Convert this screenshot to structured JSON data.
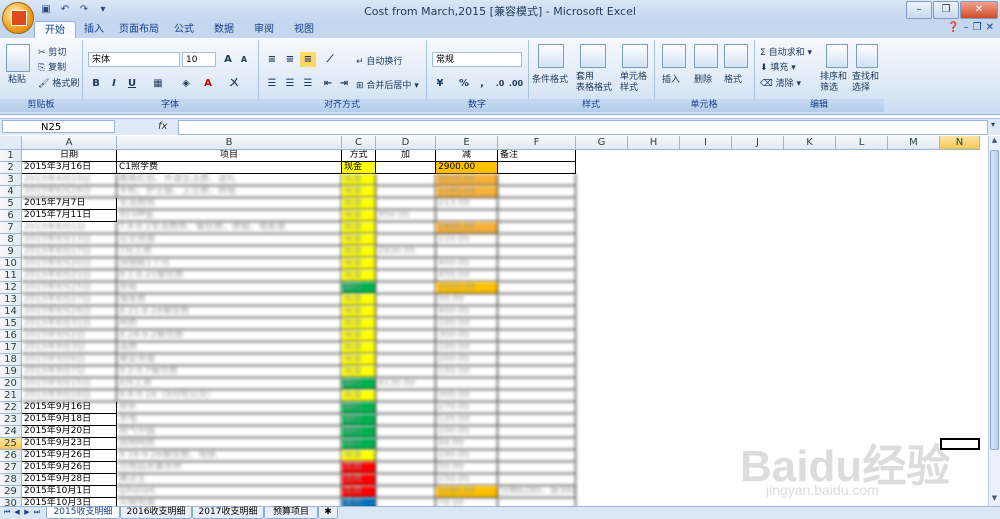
{
  "window": {
    "title": "Cost from March,2015  [兼容模式] - Microsoft Excel",
    "controls": [
      "minimize-icon",
      "restore-icon",
      "close-icon"
    ]
  },
  "ribbon_tabs": [
    "开始",
    "插入",
    "页面布局",
    "公式",
    "数据",
    "审阅",
    "视图"
  ],
  "ribbon": {
    "clipboard": {
      "paste": "粘贴",
      "cut": "剪切",
      "copy": "复制",
      "format_painter": "格式刷",
      "label": "剪贴板"
    },
    "font": {
      "name": "宋体",
      "size": "10",
      "bold": "B",
      "italic": "I",
      "underline": "U",
      "label": "字体"
    },
    "alignment": {
      "wrap": "自动换行",
      "merge": "合并后居中",
      "label": "对齐方式"
    },
    "number": {
      "format": "常规",
      "percent": "%",
      "comma": ",",
      "label": "数字"
    },
    "styles": {
      "conditional": "条件格式",
      "table": "套用\n表格格式",
      "cell": "单元格\n样式",
      "label": "样式"
    },
    "cells": {
      "insert": "插入",
      "delete": "删除",
      "format": "格式",
      "label": "单元格"
    },
    "editing": {
      "autosum": "自动求和",
      "fill": "填充",
      "clear": "清除",
      "sort": "排序和\n筛选",
      "find": "查找和\n选择",
      "label": "编辑"
    }
  },
  "formula_bar": {
    "name_box": "N25",
    "fx": "fx",
    "value": ""
  },
  "columns": [
    "A",
    "B",
    "C",
    "D",
    "E",
    "F",
    "G",
    "H",
    "I",
    "J",
    "K",
    "L",
    "M",
    "N"
  ],
  "selected_column": "N",
  "selected_row": 25,
  "header_row": {
    "date": "日期",
    "item": "项目",
    "method": "方式",
    "add": "加",
    "subtract": "减",
    "note": "备注"
  },
  "rows": [
    {
      "n": 2,
      "date": "2015年3月16日",
      "item": "C1照学费",
      "method": "现金",
      "add": "",
      "sub": "2900.00",
      "note": "",
      "mc": "#ffff00",
      "sc": "#ffc000"
    },
    {
      "n": 3,
      "date": "2015年4月10日",
      "item": "教练红包、外请生活费、送礼",
      "method": "现金",
      "add": "",
      "sub": "5670.00",
      "note": "",
      "mc": "#ffff00",
      "sc": "#f6b13a"
    },
    {
      "n": 4,
      "date": "2015年6月28日",
      "item": "手机、护士服、上交费、房租",
      "method": "现金",
      "add": "",
      "sub": "2185.00",
      "note": "",
      "mc": "#ffff00",
      "sc": "#f6b13a"
    },
    {
      "n": 5,
      "date": "2015年7月7日",
      "item": "生活费用",
      "method": "现金",
      "add": "",
      "sub": "213.00",
      "note": "",
      "mc": "#ffff00",
      "sc": ""
    },
    {
      "n": 6,
      "date": "2015年7月11日",
      "item": "803押金",
      "method": "现金",
      "add": "950.00",
      "sub": "",
      "note": "",
      "mc": "#ffff00",
      "sc": ""
    },
    {
      "n": 7,
      "date": "2015年8月1日",
      "item": "7.8-8.1生活费用、餐饮费、房租、电影票",
      "method": "现金",
      "add": "",
      "sub": "1800.00",
      "note": "",
      "mc": "#ffff00",
      "sc": "#f6b13a"
    },
    {
      "n": 8,
      "date": "2015年8月13日",
      "item": "公交充值",
      "method": "现金",
      "add": "",
      "sub": "110.00",
      "note": "",
      "mc": "#ffff00",
      "sc": ""
    },
    {
      "n": 9,
      "date": "2015年8月17日",
      "item": "7月工资",
      "method": "现金",
      "add": "2830.00",
      "sub": "",
      "note": "",
      "mc": "#ffff00",
      "sc": ""
    },
    {
      "n": 10,
      "date": "2015年8月20日",
      "item": "预借款1个月",
      "method": "现金",
      "add": "",
      "sub": "400.00",
      "note": "",
      "mc": "#ffff00",
      "sc": ""
    },
    {
      "n": 11,
      "date": "2015年8月21日",
      "item": "8.1-8.21餐饮费",
      "method": "现金",
      "add": "",
      "sub": "450.00",
      "note": "",
      "mc": "#ffff00",
      "sc": ""
    },
    {
      "n": 12,
      "date": "2015年8月25日",
      "item": "房租",
      "method": "银行",
      "add": "",
      "sub": "2000.00",
      "note": "",
      "mc": "#00b050",
      "sc": "#ffc000"
    },
    {
      "n": 13,
      "date": "2015年8月27日",
      "item": "理发费",
      "method": "现金",
      "add": "",
      "sub": "50.00",
      "note": "",
      "mc": "#ffff00",
      "sc": ""
    },
    {
      "n": 14,
      "date": "2015年8月28日",
      "item": "8.21-8.28餐饮费",
      "method": "现金",
      "add": "",
      "sub": "400.00",
      "note": "",
      "mc": "#ffff00",
      "sc": ""
    },
    {
      "n": 15,
      "date": "2015年8月31日",
      "item": "网费",
      "method": "现金",
      "add": "",
      "sub": "100.00",
      "note": "",
      "mc": "#ffff00",
      "sc": ""
    },
    {
      "n": 16,
      "date": "2015年9月2日",
      "item": "8.28-9.2餐饮费",
      "method": "现金",
      "add": "",
      "sub": "300.00",
      "note": "",
      "mc": "#ffff00",
      "sc": ""
    },
    {
      "n": 17,
      "date": "2015年9月3日",
      "item": "话费",
      "method": "现金",
      "add": "",
      "sub": "100.00",
      "note": "",
      "mc": "#ffff00",
      "sc": ""
    },
    {
      "n": 18,
      "date": "2015年9月6日",
      "item": "聚会充值",
      "method": "现金",
      "add": "",
      "sub": "200.00",
      "note": "",
      "mc": "#ffff00",
      "sc": ""
    },
    {
      "n": 19,
      "date": "2015年9月7日",
      "item": "9.2-9.7餐饮费",
      "method": "现金",
      "add": "",
      "sub": "150.00",
      "note": "",
      "mc": "#ffff00",
      "sc": ""
    },
    {
      "n": 20,
      "date": "2015年9月15日",
      "item": "8月工资",
      "method": "银行",
      "add": "4130.00",
      "sub": "",
      "note": "",
      "mc": "#00b050",
      "sc": ""
    },
    {
      "n": 21,
      "date": "2015年9月16日",
      "item": "9.8-9.16（9月吃公交）",
      "method": "现金",
      "add": "",
      "sub": "300.00",
      "note": "",
      "mc": "#ffff00",
      "sc": ""
    },
    {
      "n": 22,
      "date": "2015年9月16日",
      "item": "房补",
      "method": "银行",
      "add": "",
      "sub": "270.00",
      "note": "",
      "mc": "#00b050",
      "sc": ""
    },
    {
      "n": 23,
      "date": "2015年9月18日",
      "item": "水电",
      "method": "银行",
      "add": "",
      "sub": "120.00",
      "note": "",
      "mc": "#00b050",
      "sc": ""
    },
    {
      "n": 24,
      "date": "2015年9月20日",
      "item": "燃气中国",
      "method": "银行",
      "add": "",
      "sub": "100.00",
      "note": "",
      "mc": "#00b050",
      "sc": ""
    },
    {
      "n": 25,
      "date": "2015年9月23日",
      "item": "购物网费",
      "method": "银行",
      "add": "",
      "sub": "84.00",
      "note": "",
      "mc": "#00b050",
      "sc": ""
    },
    {
      "n": 26,
      "date": "2015年9月26日",
      "item": "9.16-9.26餐饮费、地铁",
      "method": "现金",
      "add": "",
      "sub": "190.00",
      "note": "",
      "mc": "#ffff00",
      "sc": ""
    },
    {
      "n": 27,
      "date": "2015年9月26日",
      "item": "日用品水果水杯",
      "method": "信用",
      "add": "",
      "sub": "50.00",
      "note": "",
      "mc": "#ff0000",
      "sc": ""
    },
    {
      "n": 28,
      "date": "2015年9月28日",
      "item": "美点王",
      "method": "信用",
      "add": "",
      "sub": "150.00",
      "note": "",
      "mc": "#ff0000",
      "sc": ""
    },
    {
      "n": 29,
      "date": "2015年10月1日",
      "item": "iphone6",
      "method": "信用",
      "add": "",
      "sub": "5280.00",
      "note": "分期6280，原3800",
      "mc": "#ff0000",
      "sc": "#ffc000"
    },
    {
      "n": 30,
      "date": "2015年10月3日",
      "item": "火锅充值",
      "method": "支付",
      "add": "",
      "sub": "70.00",
      "note": "",
      "mc": "#0070c0",
      "sc": ""
    }
  ],
  "sheet_tabs": [
    "2015收支明细",
    "2016收支明细",
    "2017收支明细",
    "预算项目"
  ],
  "active_sheet": "2015收支明细",
  "watermark": {
    "big": "Baidu经验",
    "small": "jingyan.baidu.com"
  }
}
